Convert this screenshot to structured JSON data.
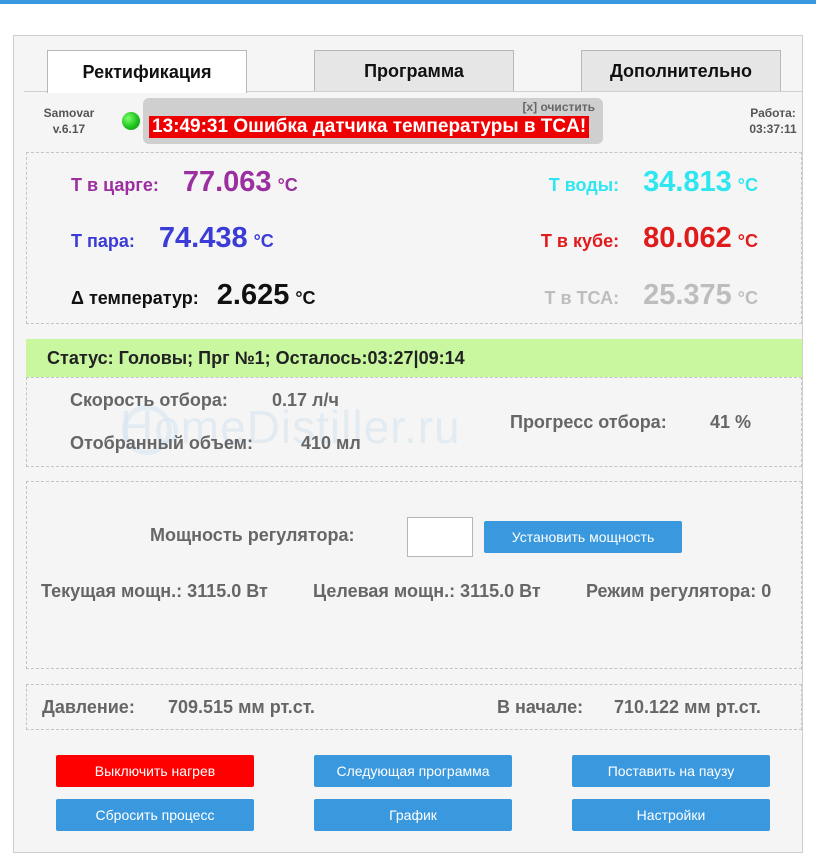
{
  "tabs": [
    {
      "label": "Ректификация"
    },
    {
      "label": "Программа"
    },
    {
      "label": "Дополнительно"
    }
  ],
  "header": {
    "app_name": "Samovar",
    "version": "v.6.17",
    "clear_label": "[x] очистить",
    "alert": "13:49:31 Ошибка датчика температуры в TCA!",
    "work_label": "Работа:",
    "work_time": "03:37:11"
  },
  "temps": {
    "column": {
      "label": "Т в царге:",
      "value": "77.063",
      "unit": "°C",
      "color": "#9b2fa0"
    },
    "steam": {
      "label": "Т пара:",
      "value": "74.438",
      "unit": "°C",
      "color": "#3b3bd6"
    },
    "delta": {
      "label": "Δ температур:",
      "value": "2.625",
      "unit": "°C",
      "color": "#111111"
    },
    "water": {
      "label": "Т воды:",
      "value": "34.813",
      "unit": "°C",
      "color": "#2ee6f0"
    },
    "cube": {
      "label": "Т в кубе:",
      "value": "80.062",
      "unit": "°C",
      "color": "#e01b1b"
    },
    "tsa": {
      "label": "Т в ТСА:",
      "value": "25.375",
      "unit": "°C",
      "color": "#bdbdbd"
    }
  },
  "status": {
    "text": "Статус: Головы; Прг №1; Осталось:03:27|09:14",
    "bg": "#c8f7a0"
  },
  "selection": {
    "speed_label": "Скорость отбора:",
    "speed_value": "0.17 л/ч",
    "volume_label": "Отобранный объем:",
    "volume_value": "410 мл",
    "progress_label": "Прогресс отбора:",
    "progress_value": "41 %"
  },
  "watermark": "HomeDistiller.ru",
  "power": {
    "label": "Мощность регулятора:",
    "input_value": "",
    "set_button": "Установить мощность",
    "current": "Текущая мощн.: 3115.0 Вт",
    "target": "Целевая мощн.: 3115.0 Вт",
    "mode": "Режим регулятора: 0"
  },
  "pressure": {
    "label": "Давление:",
    "value": "709.515 мм рт.ст.",
    "start_label": "В начале:",
    "start_value": "710.122 мм рт.ст."
  },
  "buttons": {
    "heat_off": "Выключить нагрев",
    "next_program": "Следующая программа",
    "pause": "Поставить на паузу",
    "reset": "Сбросить процесс",
    "chart": "График",
    "settings": "Настройки"
  },
  "colors": {
    "accent": "#3a99de",
    "danger": "#ff0000",
    "status_bg": "#c8f7a0"
  }
}
